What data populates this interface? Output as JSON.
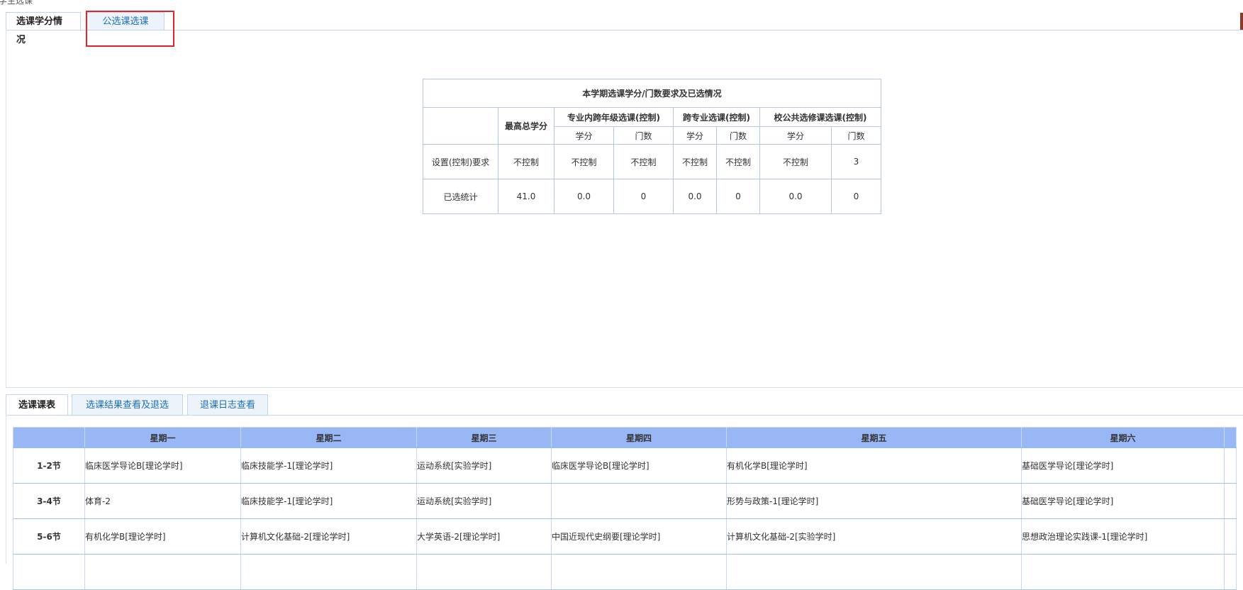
{
  "page": {
    "title": "学生选课"
  },
  "top_tabs": [
    {
      "label": "选课学分情况",
      "active": true
    },
    {
      "label": "公选课选课",
      "active": false
    }
  ],
  "credit_table": {
    "title": "本学期选课学分/门数要求及已选情况",
    "col_max": "最高总学分",
    "group1": "专业内跨年级选课(控制)",
    "group2": "跨专业选课(控制)",
    "group3": "校公共选修课选课(控制)",
    "sub_credit": "学分",
    "sub_count": "门数",
    "rows": [
      {
        "label": "设置(控制)要求",
        "max": "不控制",
        "g1_credit": "不控制",
        "g1_count": "不控制",
        "g2_credit": "不控制",
        "g2_count": "不控制",
        "g3_credit": "不控制",
        "g3_count": "3"
      },
      {
        "label": "已选统计",
        "max": "41.0",
        "g1_credit": "0.0",
        "g1_count": "0",
        "g2_credit": "0.0",
        "g2_count": "0",
        "g3_credit": "0.0",
        "g3_count": "0"
      }
    ]
  },
  "bottom_tabs": [
    {
      "label": "选课课表",
      "active": true
    },
    {
      "label": "选课结果查看及退选",
      "active": false
    },
    {
      "label": "退课日志查看",
      "active": false
    }
  ],
  "schedule": {
    "days": [
      "星期一",
      "星期二",
      "星期三",
      "星期四",
      "星期五",
      "星期六"
    ],
    "rows": [
      {
        "period": "1-2节",
        "cells": [
          "临床医学导论B[理论学时]",
          "临床技能学-1[理论学时]",
          "运动系统[实验学时]",
          "临床医学导论B[理论学时]",
          "有机化学B[理论学时]",
          "基础医学导论[理论学时]"
        ]
      },
      {
        "period": "3-4节",
        "cells": [
          "体育-2",
          "临床技能学-1[理论学时]",
          "运动系统[实验学时]",
          "",
          "形势与政策-1[理论学时]",
          "基础医学导论[理论学时]"
        ]
      },
      {
        "period": "5-6节",
        "cells": [
          "有机化学B[理论学时]",
          "计算机文化基础-2[理论学时]",
          "大学英语-2[理论学时]",
          "中国近现代史纲要[理论学时]",
          "计算机文化基础-2[实验学时]",
          "思想政治理论实践课-1[理论学时]"
        ]
      },
      {
        "period": "",
        "cells": [
          "",
          "",
          "",
          "",
          "",
          ""
        ]
      }
    ]
  },
  "colors": {
    "highlight": "#e0262a",
    "header_bg": "#99b6f5",
    "tab_text": "#1d6fb6"
  }
}
